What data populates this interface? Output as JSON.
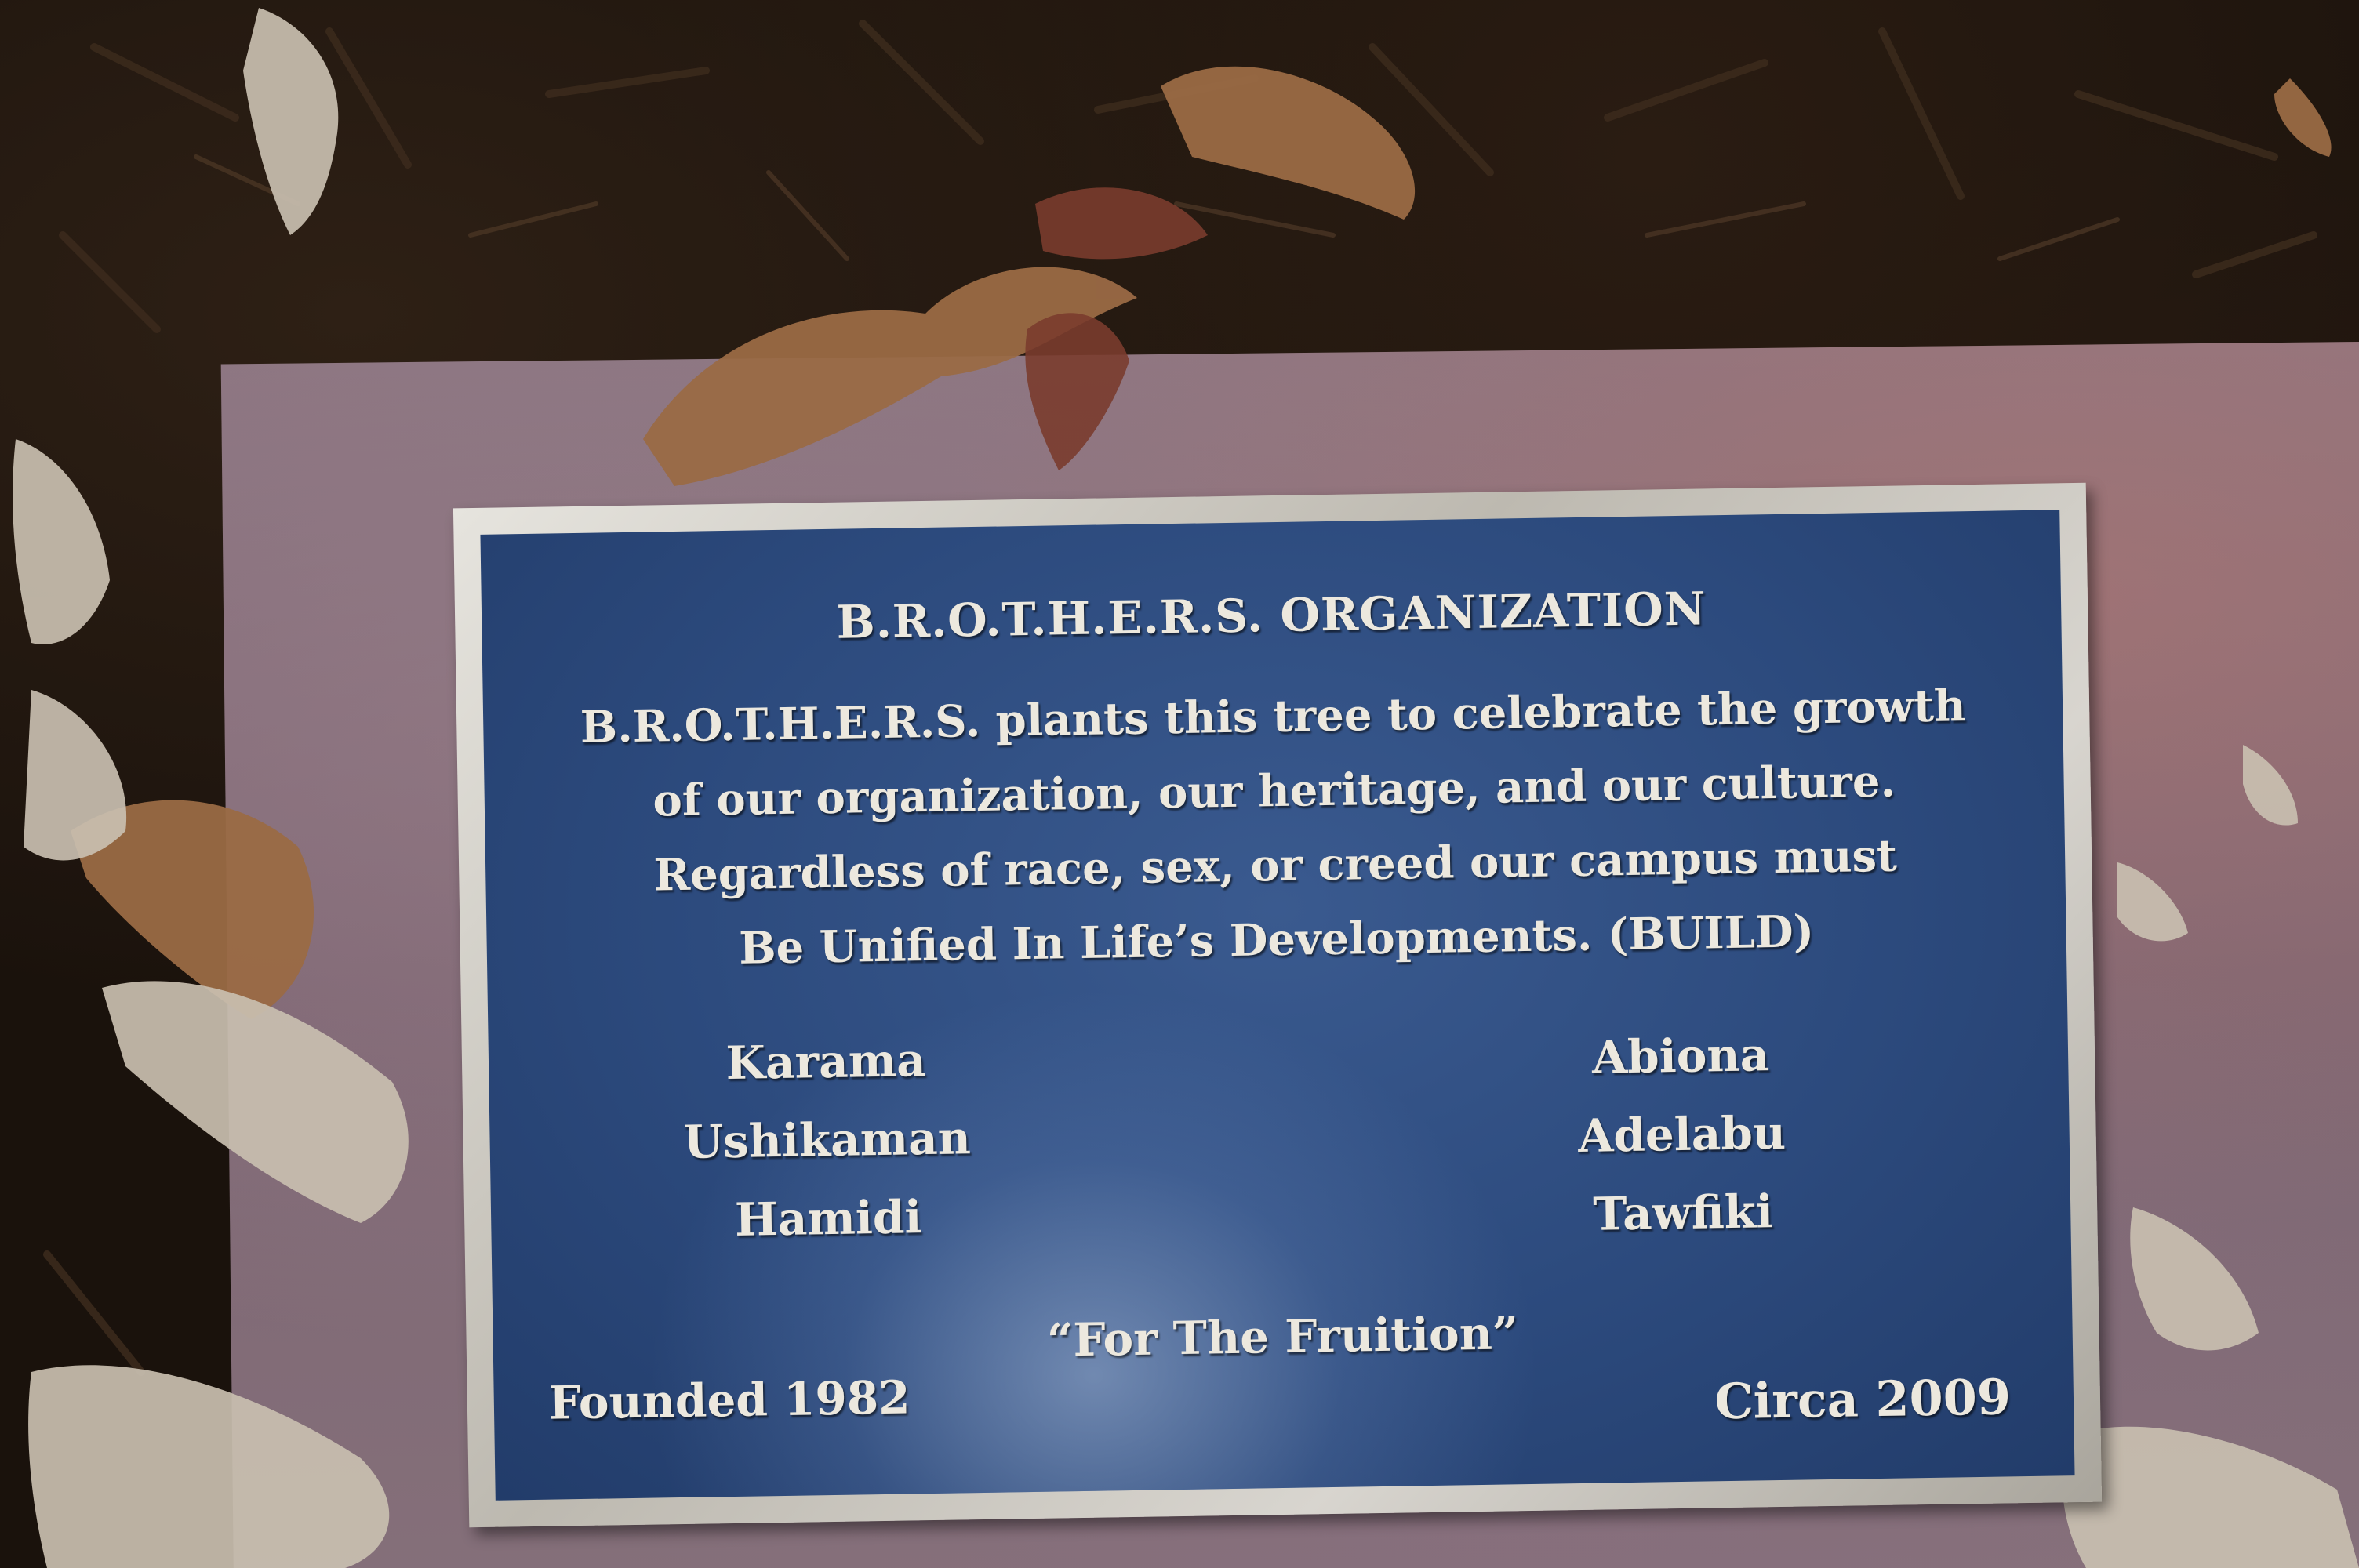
{
  "plaque": {
    "title": "B.R.O.T.H.E.R.S. ORGANIZATION",
    "body_lines": [
      "B.R.O.T.H.E.R.S. plants this tree to celebrate the growth",
      "of our organization, our heritage, and our culture.",
      "Regardless of race, sex, or creed our campus must",
      "Be Unified In Life’s Developments. (BUILD)"
    ],
    "names_left": [
      "Karama",
      "Ushikaman",
      "Hamidi"
    ],
    "names_right": [
      "Abiona",
      "Adelabu",
      "Tawfiki"
    ],
    "motto": "“For The Fruition”",
    "founded": "Founded 1982",
    "circa": "Circa 2009"
  },
  "colors": {
    "plaque_face": "#2c4a7d",
    "plaque_text": "#ece8de",
    "plaque_border": "#d8d5cf",
    "stone": "#7d6673",
    "mulch": "#1a120c",
    "leaf_brown": "#9a6a45",
    "leaf_pale": "#c9bfb0"
  }
}
